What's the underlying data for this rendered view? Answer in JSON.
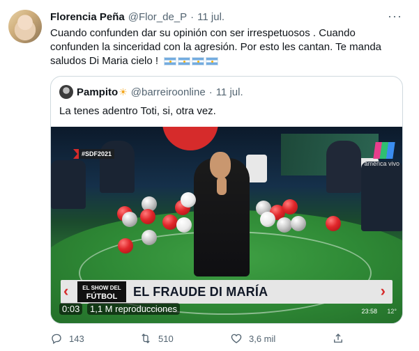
{
  "tweet": {
    "author_name": "Florencia Peña",
    "author_handle": "@Flor_de_P",
    "separator": "·",
    "date": "11 jul.",
    "more_icon": "more-horizontal-icon",
    "text": "Cuando confunden dar su opinión con ser irrespetuosos . Cuando confunden la sinceridad con la agresión. Por esto les cantan. Te manda saludos Di Maria cielo !",
    "flag_count": 4
  },
  "quote": {
    "author_name": "Pampito",
    "author_emoji": "☀",
    "author_handle": "@barreiroonline",
    "separator": "·",
    "date": "11 jul.",
    "text": "La tenes adentro Toti, si, otra vez."
  },
  "video": {
    "hashtag": "#SDF2021",
    "channel_label": "américa vivo",
    "banner_logo_line1": "EL SHOW DEL",
    "banner_logo_line2": "FÚTBOL",
    "banner_title": "EL FRAUDE DI MARÍA",
    "elapsed": "0:03",
    "views": "1,1 M reproducciones",
    "tv_clock": "23:58",
    "tv_temp": "12°",
    "accent_color": "#d62b2b"
  },
  "actions": {
    "replies": "143",
    "retweets": "510",
    "likes": "3,6 mil",
    "icons": [
      "reply-icon",
      "retweet-icon",
      "like-icon",
      "share-icon"
    ]
  }
}
